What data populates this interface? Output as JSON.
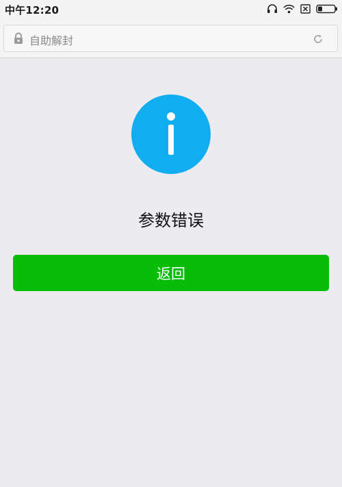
{
  "status_bar": {
    "time": "中午12:20",
    "icons": [
      "headphones-icon",
      "wifi-icon",
      "sim-disabled-icon",
      "battery-icon"
    ]
  },
  "address_bar": {
    "title": "自助解封",
    "lock_icon": "lock-icon",
    "refresh_icon": "refresh-icon"
  },
  "main": {
    "status_icon": "info-icon",
    "message": "参数错误",
    "back_button_label": "返回"
  },
  "colors": {
    "info": "#10aef0",
    "primary_button": "#07bd07",
    "background": "#ececf0"
  }
}
